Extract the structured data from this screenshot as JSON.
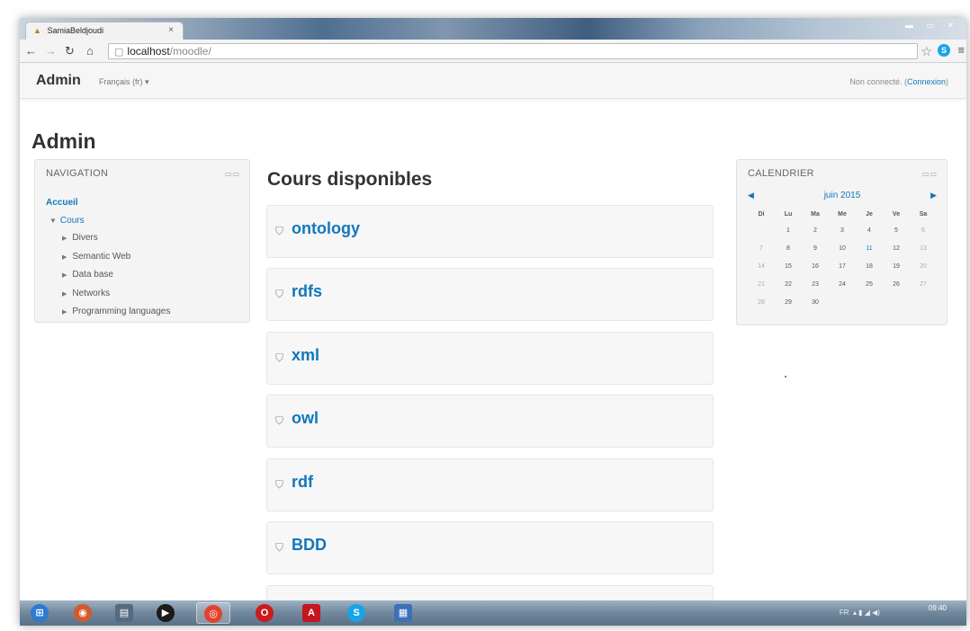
{
  "browser": {
    "tab_title": "SamiaBeldjoudi",
    "tab_close": "×",
    "address_host": "localhost",
    "address_path": "/moodle/"
  },
  "navbar": {
    "brand": "Admin",
    "language": "Français (fr) ▾",
    "login_prefix": "Non connecté. (",
    "login_link": "Connexion",
    "login_suffix": ")"
  },
  "page": {
    "heading": "Admin"
  },
  "navigation": {
    "title": "NAVIGATION",
    "home": "Accueil",
    "courses": "Cours",
    "items": [
      "Divers",
      "Semantic Web",
      "Data base",
      "Networks",
      "Programming languages"
    ]
  },
  "main": {
    "title": "Cours disponibles",
    "courses": [
      "ontology",
      "rdfs",
      "xml",
      "owl",
      "rdf",
      "BDD"
    ]
  },
  "calendar": {
    "title": "CALENDRIER",
    "month": "juin 2015",
    "days": [
      "Di",
      "Lu",
      "Ma",
      "Me",
      "Je",
      "Ve",
      "Sa"
    ],
    "weeks": [
      [
        "",
        "1",
        "2",
        "3",
        "4",
        "5",
        "6"
      ],
      [
        "7",
        "8",
        "9",
        "10",
        "11",
        "12",
        "13"
      ],
      [
        "14",
        "15",
        "16",
        "17",
        "18",
        "19",
        "20"
      ],
      [
        "21",
        "22",
        "23",
        "24",
        "25",
        "26",
        "27"
      ],
      [
        "28",
        "29",
        "30",
        "",
        "",
        "",
        ""
      ]
    ],
    "highlight": "11"
  },
  "taskbar": {
    "language": "FR",
    "time": "09:40"
  },
  "colors": {
    "link": "#1177bb",
    "block_background": "#f4f4f4",
    "taskbar": "#6f869c"
  }
}
